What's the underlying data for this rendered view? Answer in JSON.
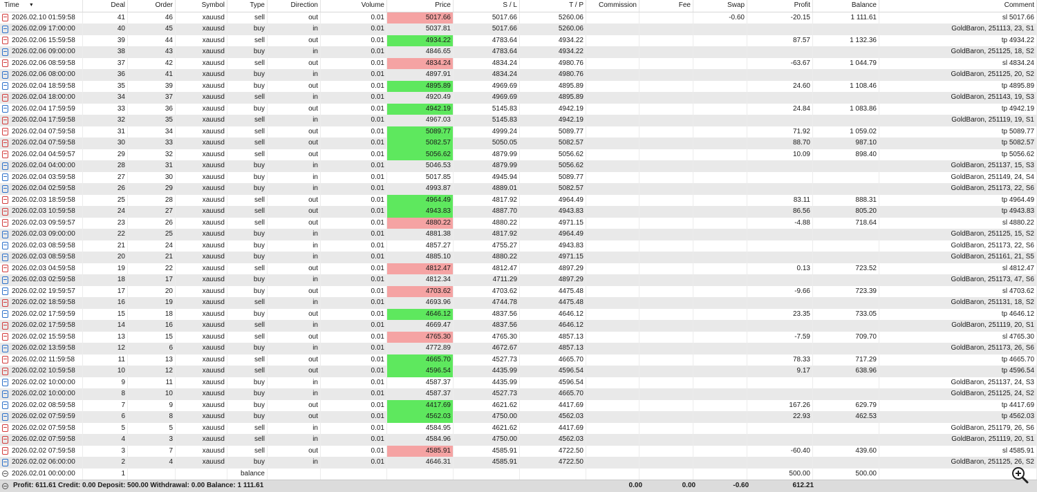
{
  "columns": [
    "Time",
    "Deal",
    "Order",
    "Symbol",
    "Type",
    "Direction",
    "Volume",
    "Price",
    "S / L",
    "T / P",
    "Commission",
    "Fee",
    "Swap",
    "Profit",
    "Balance",
    "Comment"
  ],
  "rows": [
    {
      "time": "2026.02.10 01:59:58",
      "deal": "41",
      "order": "46",
      "symbol": "xauusd",
      "type": "sell",
      "direction": "out",
      "volume": "0.01",
      "price": "5017.66",
      "sl": "5017.66",
      "tp": "5260.06",
      "commission": "",
      "fee": "",
      "swap": "-0.60",
      "profit": "-20.15",
      "balance": "1 111.61",
      "comment": "sl 5017.66",
      "hl": "red",
      "icon": "sell"
    },
    {
      "time": "2026.02.09 17:00:00",
      "deal": "40",
      "order": "45",
      "symbol": "xauusd",
      "type": "buy",
      "direction": "in",
      "volume": "0.01",
      "price": "5037.81",
      "sl": "5017.66",
      "tp": "5260.06",
      "commission": "",
      "fee": "",
      "swap": "",
      "profit": "",
      "balance": "",
      "comment": "GoldBaron, 251113, 23, S1",
      "hl": "",
      "icon": "buy"
    },
    {
      "time": "2026.02.06 15:59:58",
      "deal": "39",
      "order": "44",
      "symbol": "xauusd",
      "type": "sell",
      "direction": "out",
      "volume": "0.01",
      "price": "4934.22",
      "sl": "4783.64",
      "tp": "4934.22",
      "commission": "",
      "fee": "",
      "swap": "",
      "profit": "87.57",
      "balance": "1 132.36",
      "comment": "tp 4934.22",
      "hl": "green",
      "icon": "sell"
    },
    {
      "time": "2026.02.06 09:00:00",
      "deal": "38",
      "order": "43",
      "symbol": "xauusd",
      "type": "buy",
      "direction": "in",
      "volume": "0.01",
      "price": "4846.65",
      "sl": "4783.64",
      "tp": "4934.22",
      "commission": "",
      "fee": "",
      "swap": "",
      "profit": "",
      "balance": "",
      "comment": "GoldBaron, 251125, 18, S2",
      "hl": "",
      "icon": "buy"
    },
    {
      "time": "2026.02.06 08:59:58",
      "deal": "37",
      "order": "42",
      "symbol": "xauusd",
      "type": "sell",
      "direction": "out",
      "volume": "0.01",
      "price": "4834.24",
      "sl": "4834.24",
      "tp": "4980.76",
      "commission": "",
      "fee": "",
      "swap": "",
      "profit": "-63.67",
      "balance": "1 044.79",
      "comment": "sl 4834.24",
      "hl": "red",
      "icon": "sell"
    },
    {
      "time": "2026.02.06 08:00:00",
      "deal": "36",
      "order": "41",
      "symbol": "xauusd",
      "type": "buy",
      "direction": "in",
      "volume": "0.01",
      "price": "4897.91",
      "sl": "4834.24",
      "tp": "4980.76",
      "commission": "",
      "fee": "",
      "swap": "",
      "profit": "",
      "balance": "",
      "comment": "GoldBaron, 251125, 20, S2",
      "hl": "",
      "icon": "buy"
    },
    {
      "time": "2026.02.04 18:59:58",
      "deal": "35",
      "order": "39",
      "symbol": "xauusd",
      "type": "buy",
      "direction": "out",
      "volume": "0.01",
      "price": "4895.89",
      "sl": "4969.69",
      "tp": "4895.89",
      "commission": "",
      "fee": "",
      "swap": "",
      "profit": "24.60",
      "balance": "1 108.46",
      "comment": "tp 4895.89",
      "hl": "green",
      "icon": "buy"
    },
    {
      "time": "2026.02.04 18:00:00",
      "deal": "34",
      "order": "37",
      "symbol": "xauusd",
      "type": "sell",
      "direction": "in",
      "volume": "0.01",
      "price": "4920.49",
      "sl": "4969.69",
      "tp": "4895.89",
      "commission": "",
      "fee": "",
      "swap": "",
      "profit": "",
      "balance": "",
      "comment": "GoldBaron, 251143, 19, S3",
      "hl": "",
      "icon": "sell"
    },
    {
      "time": "2026.02.04 17:59:59",
      "deal": "33",
      "order": "36",
      "symbol": "xauusd",
      "type": "buy",
      "direction": "out",
      "volume": "0.01",
      "price": "4942.19",
      "sl": "5145.83",
      "tp": "4942.19",
      "commission": "",
      "fee": "",
      "swap": "",
      "profit": "24.84",
      "balance": "1 083.86",
      "comment": "tp 4942.19",
      "hl": "green",
      "icon": "buy"
    },
    {
      "time": "2026.02.04 17:59:58",
      "deal": "32",
      "order": "35",
      "symbol": "xauusd",
      "type": "sell",
      "direction": "in",
      "volume": "0.01",
      "price": "4967.03",
      "sl": "5145.83",
      "tp": "4942.19",
      "commission": "",
      "fee": "",
      "swap": "",
      "profit": "",
      "balance": "",
      "comment": "GoldBaron, 251119, 19, S1",
      "hl": "",
      "icon": "sell"
    },
    {
      "time": "2026.02.04 07:59:58",
      "deal": "31",
      "order": "34",
      "symbol": "xauusd",
      "type": "sell",
      "direction": "out",
      "volume": "0.01",
      "price": "5089.77",
      "sl": "4999.24",
      "tp": "5089.77",
      "commission": "",
      "fee": "",
      "swap": "",
      "profit": "71.92",
      "balance": "1 059.02",
      "comment": "tp 5089.77",
      "hl": "green",
      "icon": "sell"
    },
    {
      "time": "2026.02.04 07:59:58",
      "deal": "30",
      "order": "33",
      "symbol": "xauusd",
      "type": "sell",
      "direction": "out",
      "volume": "0.01",
      "price": "5082.57",
      "sl": "5050.05",
      "tp": "5082.57",
      "commission": "",
      "fee": "",
      "swap": "",
      "profit": "88.70",
      "balance": "987.10",
      "comment": "tp 5082.57",
      "hl": "green",
      "icon": "sell"
    },
    {
      "time": "2026.02.04 04:59:57",
      "deal": "29",
      "order": "32",
      "symbol": "xauusd",
      "type": "sell",
      "direction": "out",
      "volume": "0.01",
      "price": "5056.62",
      "sl": "4879.99",
      "tp": "5056.62",
      "commission": "",
      "fee": "",
      "swap": "",
      "profit": "10.09",
      "balance": "898.40",
      "comment": "tp 5056.62",
      "hl": "green",
      "icon": "sell"
    },
    {
      "time": "2026.02.04 04:00:00",
      "deal": "28",
      "order": "31",
      "symbol": "xauusd",
      "type": "buy",
      "direction": "in",
      "volume": "0.01",
      "price": "5046.53",
      "sl": "4879.99",
      "tp": "5056.62",
      "commission": "",
      "fee": "",
      "swap": "",
      "profit": "",
      "balance": "",
      "comment": "GoldBaron, 251137, 15, S3",
      "hl": "",
      "icon": "buy"
    },
    {
      "time": "2026.02.04 03:59:58",
      "deal": "27",
      "order": "30",
      "symbol": "xauusd",
      "type": "buy",
      "direction": "in",
      "volume": "0.01",
      "price": "5017.85",
      "sl": "4945.94",
      "tp": "5089.77",
      "commission": "",
      "fee": "",
      "swap": "",
      "profit": "",
      "balance": "",
      "comment": "GoldBaron, 251149, 24, S4",
      "hl": "",
      "icon": "buy"
    },
    {
      "time": "2026.02.04 02:59:58",
      "deal": "26",
      "order": "29",
      "symbol": "xauusd",
      "type": "buy",
      "direction": "in",
      "volume": "0.01",
      "price": "4993.87",
      "sl": "4889.01",
      "tp": "5082.57",
      "commission": "",
      "fee": "",
      "swap": "",
      "profit": "",
      "balance": "",
      "comment": "GoldBaron, 251173, 22, S6",
      "hl": "",
      "icon": "buy"
    },
    {
      "time": "2026.02.03 18:59:58",
      "deal": "25",
      "order": "28",
      "symbol": "xauusd",
      "type": "sell",
      "direction": "out",
      "volume": "0.01",
      "price": "4964.49",
      "sl": "4817.92",
      "tp": "4964.49",
      "commission": "",
      "fee": "",
      "swap": "",
      "profit": "83.11",
      "balance": "888.31",
      "comment": "tp 4964.49",
      "hl": "green",
      "icon": "sell"
    },
    {
      "time": "2026.02.03 10:59:58",
      "deal": "24",
      "order": "27",
      "symbol": "xauusd",
      "type": "sell",
      "direction": "out",
      "volume": "0.01",
      "price": "4943.83",
      "sl": "4887.70",
      "tp": "4943.83",
      "commission": "",
      "fee": "",
      "swap": "",
      "profit": "86.56",
      "balance": "805.20",
      "comment": "tp 4943.83",
      "hl": "green",
      "icon": "sell"
    },
    {
      "time": "2026.02.03 09:59:57",
      "deal": "23",
      "order": "26",
      "symbol": "xauusd",
      "type": "sell",
      "direction": "out",
      "volume": "0.01",
      "price": "4880.22",
      "sl": "4880.22",
      "tp": "4971.15",
      "commission": "",
      "fee": "",
      "swap": "",
      "profit": "-4.88",
      "balance": "718.64",
      "comment": "sl 4880.22",
      "hl": "red",
      "icon": "sell"
    },
    {
      "time": "2026.02.03 09:00:00",
      "deal": "22",
      "order": "25",
      "symbol": "xauusd",
      "type": "buy",
      "direction": "in",
      "volume": "0.01",
      "price": "4881.38",
      "sl": "4817.92",
      "tp": "4964.49",
      "commission": "",
      "fee": "",
      "swap": "",
      "profit": "",
      "balance": "",
      "comment": "GoldBaron, 251125, 15, S2",
      "hl": "",
      "icon": "buy"
    },
    {
      "time": "2026.02.03 08:59:58",
      "deal": "21",
      "order": "24",
      "symbol": "xauusd",
      "type": "buy",
      "direction": "in",
      "volume": "0.01",
      "price": "4857.27",
      "sl": "4755.27",
      "tp": "4943.83",
      "commission": "",
      "fee": "",
      "swap": "",
      "profit": "",
      "balance": "",
      "comment": "GoldBaron, 251173, 22, S6",
      "hl": "",
      "icon": "buy"
    },
    {
      "time": "2026.02.03 08:59:58",
      "deal": "20",
      "order": "21",
      "symbol": "xauusd",
      "type": "buy",
      "direction": "in",
      "volume": "0.01",
      "price": "4885.10",
      "sl": "4880.22",
      "tp": "4971.15",
      "commission": "",
      "fee": "",
      "swap": "",
      "profit": "",
      "balance": "",
      "comment": "GoldBaron, 251161, 21, S5",
      "hl": "",
      "icon": "buy"
    },
    {
      "time": "2026.02.03 04:59:58",
      "deal": "19",
      "order": "22",
      "symbol": "xauusd",
      "type": "sell",
      "direction": "out",
      "volume": "0.01",
      "price": "4812.47",
      "sl": "4812.47",
      "tp": "4897.29",
      "commission": "",
      "fee": "",
      "swap": "",
      "profit": "0.13",
      "balance": "723.52",
      "comment": "sl 4812.47",
      "hl": "red",
      "icon": "sell"
    },
    {
      "time": "2026.02.03 02:59:58",
      "deal": "18",
      "order": "17",
      "symbol": "xauusd",
      "type": "buy",
      "direction": "in",
      "volume": "0.01",
      "price": "4812.34",
      "sl": "4711.29",
      "tp": "4897.29",
      "commission": "",
      "fee": "",
      "swap": "",
      "profit": "",
      "balance": "",
      "comment": "GoldBaron, 251173, 47, S6",
      "hl": "",
      "icon": "buy"
    },
    {
      "time": "2026.02.02 19:59:57",
      "deal": "17",
      "order": "20",
      "symbol": "xauusd",
      "type": "buy",
      "direction": "out",
      "volume": "0.01",
      "price": "4703.62",
      "sl": "4703.62",
      "tp": "4475.48",
      "commission": "",
      "fee": "",
      "swap": "",
      "profit": "-9.66",
      "balance": "723.39",
      "comment": "sl 4703.62",
      "hl": "red",
      "icon": "buy"
    },
    {
      "time": "2026.02.02 18:59:58",
      "deal": "16",
      "order": "19",
      "symbol": "xauusd",
      "type": "sell",
      "direction": "in",
      "volume": "0.01",
      "price": "4693.96",
      "sl": "4744.78",
      "tp": "4475.48",
      "commission": "",
      "fee": "",
      "swap": "",
      "profit": "",
      "balance": "",
      "comment": "GoldBaron, 251131, 18, S2",
      "hl": "",
      "icon": "sell"
    },
    {
      "time": "2026.02.02 17:59:59",
      "deal": "15",
      "order": "18",
      "symbol": "xauusd",
      "type": "buy",
      "direction": "out",
      "volume": "0.01",
      "price": "4646.12",
      "sl": "4837.56",
      "tp": "4646.12",
      "commission": "",
      "fee": "",
      "swap": "",
      "profit": "23.35",
      "balance": "733.05",
      "comment": "tp 4646.12",
      "hl": "green",
      "icon": "buy"
    },
    {
      "time": "2026.02.02 17:59:58",
      "deal": "14",
      "order": "16",
      "symbol": "xauusd",
      "type": "sell",
      "direction": "in",
      "volume": "0.01",
      "price": "4669.47",
      "sl": "4837.56",
      "tp": "4646.12",
      "commission": "",
      "fee": "",
      "swap": "",
      "profit": "",
      "balance": "",
      "comment": "GoldBaron, 251119, 20, S1",
      "hl": "",
      "icon": "sell"
    },
    {
      "time": "2026.02.02 15:59:58",
      "deal": "13",
      "order": "15",
      "symbol": "xauusd",
      "type": "sell",
      "direction": "out",
      "volume": "0.01",
      "price": "4765.30",
      "sl": "4765.30",
      "tp": "4857.13",
      "commission": "",
      "fee": "",
      "swap": "",
      "profit": "-7.59",
      "balance": "709.70",
      "comment": "sl 4765.30",
      "hl": "red",
      "icon": "sell"
    },
    {
      "time": "2026.02.02 13:59:58",
      "deal": "12",
      "order": "6",
      "symbol": "xauusd",
      "type": "buy",
      "direction": "in",
      "volume": "0.01",
      "price": "4772.89",
      "sl": "4672.67",
      "tp": "4857.13",
      "commission": "",
      "fee": "",
      "swap": "",
      "profit": "",
      "balance": "",
      "comment": "GoldBaron, 251173, 26, S6",
      "hl": "",
      "icon": "buy"
    },
    {
      "time": "2026.02.02 11:59:58",
      "deal": "11",
      "order": "13",
      "symbol": "xauusd",
      "type": "sell",
      "direction": "out",
      "volume": "0.01",
      "price": "4665.70",
      "sl": "4527.73",
      "tp": "4665.70",
      "commission": "",
      "fee": "",
      "swap": "",
      "profit": "78.33",
      "balance": "717.29",
      "comment": "tp 4665.70",
      "hl": "green",
      "icon": "sell"
    },
    {
      "time": "2026.02.02 10:59:58",
      "deal": "10",
      "order": "12",
      "symbol": "xauusd",
      "type": "sell",
      "direction": "out",
      "volume": "0.01",
      "price": "4596.54",
      "sl": "4435.99",
      "tp": "4596.54",
      "commission": "",
      "fee": "",
      "swap": "",
      "profit": "9.17",
      "balance": "638.96",
      "comment": "tp 4596.54",
      "hl": "green",
      "icon": "sell"
    },
    {
      "time": "2026.02.02 10:00:00",
      "deal": "9",
      "order": "11",
      "symbol": "xauusd",
      "type": "buy",
      "direction": "in",
      "volume": "0.01",
      "price": "4587.37",
      "sl": "4435.99",
      "tp": "4596.54",
      "commission": "",
      "fee": "",
      "swap": "",
      "profit": "",
      "balance": "",
      "comment": "GoldBaron, 251137, 24, S3",
      "hl": "",
      "icon": "buy"
    },
    {
      "time": "2026.02.02 10:00:00",
      "deal": "8",
      "order": "10",
      "symbol": "xauusd",
      "type": "buy",
      "direction": "in",
      "volume": "0.01",
      "price": "4587.37",
      "sl": "4527.73",
      "tp": "4665.70",
      "commission": "",
      "fee": "",
      "swap": "",
      "profit": "",
      "balance": "",
      "comment": "GoldBaron, 251125, 24, S2",
      "hl": "",
      "icon": "buy"
    },
    {
      "time": "2026.02.02 08:59:58",
      "deal": "7",
      "order": "9",
      "symbol": "xauusd",
      "type": "buy",
      "direction": "out",
      "volume": "0.01",
      "price": "4417.69",
      "sl": "4621.62",
      "tp": "4417.69",
      "commission": "",
      "fee": "",
      "swap": "",
      "profit": "167.26",
      "balance": "629.79",
      "comment": "tp 4417.69",
      "hl": "green",
      "icon": "buy"
    },
    {
      "time": "2026.02.02 07:59:59",
      "deal": "6",
      "order": "8",
      "symbol": "xauusd",
      "type": "buy",
      "direction": "out",
      "volume": "0.01",
      "price": "4562.03",
      "sl": "4750.00",
      "tp": "4562.03",
      "commission": "",
      "fee": "",
      "swap": "",
      "profit": "22.93",
      "balance": "462.53",
      "comment": "tp 4562.03",
      "hl": "green",
      "icon": "buy"
    },
    {
      "time": "2026.02.02 07:59:58",
      "deal": "5",
      "order": "5",
      "symbol": "xauusd",
      "type": "sell",
      "direction": "in",
      "volume": "0.01",
      "price": "4584.95",
      "sl": "4621.62",
      "tp": "4417.69",
      "commission": "",
      "fee": "",
      "swap": "",
      "profit": "",
      "balance": "",
      "comment": "GoldBaron, 251179, 26, S6",
      "hl": "",
      "icon": "sell"
    },
    {
      "time": "2026.02.02 07:59:58",
      "deal": "4",
      "order": "3",
      "symbol": "xauusd",
      "type": "sell",
      "direction": "in",
      "volume": "0.01",
      "price": "4584.96",
      "sl": "4750.00",
      "tp": "4562.03",
      "commission": "",
      "fee": "",
      "swap": "",
      "profit": "",
      "balance": "",
      "comment": "GoldBaron, 251119, 20, S1",
      "hl": "",
      "icon": "sell"
    },
    {
      "time": "2026.02.02 07:59:58",
      "deal": "3",
      "order": "7",
      "symbol": "xauusd",
      "type": "sell",
      "direction": "out",
      "volume": "0.01",
      "price": "4585.91",
      "sl": "4585.91",
      "tp": "4722.50",
      "commission": "",
      "fee": "",
      "swap": "",
      "profit": "-60.40",
      "balance": "439.60",
      "comment": "sl 4585.91",
      "hl": "red",
      "icon": "sell"
    },
    {
      "time": "2026.02.02 06:00:00",
      "deal": "2",
      "order": "4",
      "symbol": "xauusd",
      "type": "buy",
      "direction": "in",
      "volume": "0.01",
      "price": "4646.31",
      "sl": "4585.91",
      "tp": "4722.50",
      "commission": "",
      "fee": "",
      "swap": "",
      "profit": "",
      "balance": "",
      "comment": "GoldBaron, 251125, 26, S2",
      "hl": "",
      "icon": "buy"
    },
    {
      "time": "2026.02.01 00:00:00",
      "deal": "1",
      "order": "",
      "symbol": "",
      "type": "balance",
      "direction": "",
      "volume": "",
      "price": "",
      "sl": "",
      "tp": "",
      "commission": "",
      "fee": "",
      "swap": "",
      "profit": "500.00",
      "balance": "500.00",
      "comment": "",
      "hl": "",
      "icon": "balance"
    }
  ],
  "footer": {
    "summary": "Profit: 611.61  Credit: 0.00  Deposit: 500.00  Withdrawal: 0.00  Balance: 1 111.61",
    "commission": "0.00",
    "fee": "0.00",
    "swap": "-0.60",
    "profit": "612.21"
  },
  "icons": {
    "sort": "sort-desc-icon",
    "zoom": "magnifier-plus-icon",
    "summary": "balance-circle-icon"
  },
  "colors": {
    "gain": "#5ee85e",
    "loss": "#f5a3a3",
    "sell": "#d23a3a",
    "buy": "#2a6fc9"
  }
}
